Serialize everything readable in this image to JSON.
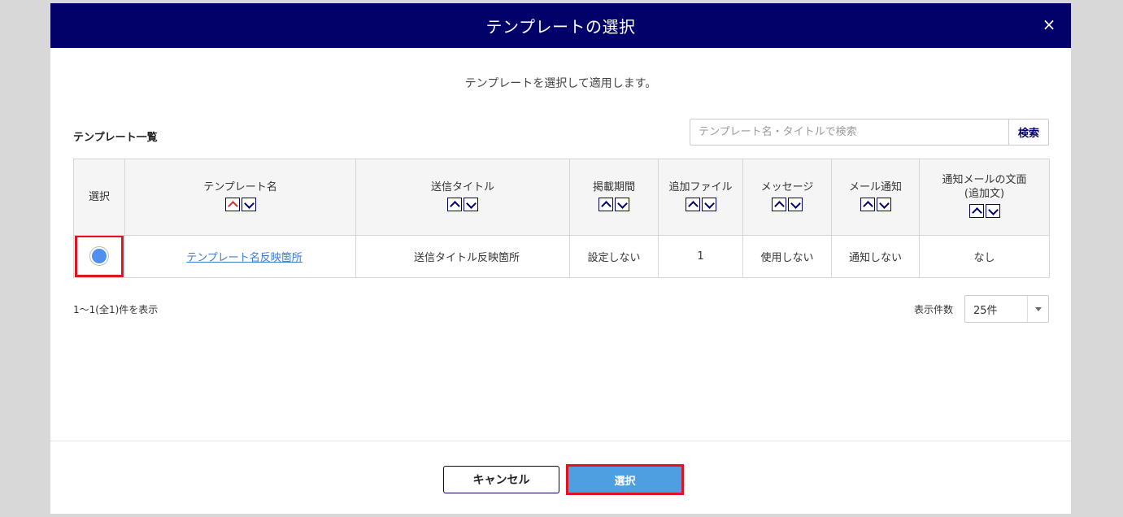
{
  "dialog": {
    "title": "テンプレートの選択",
    "close_label": "×",
    "description": "テンプレートを選択して適用します。"
  },
  "list": {
    "title": "テンプレート一覧",
    "search_placeholder": "テンプレート名・タイトルで検索",
    "search_button": "検索"
  },
  "table": {
    "headers": {
      "select": "選択",
      "template_name": "テンプレート名",
      "send_title": "送信タイトル",
      "period": "掲載期間",
      "attachment": "追加ファイル",
      "message": "メッセージ",
      "mail_notify": "メール通知",
      "mail_body_line1": "通知メールの文面",
      "mail_body_line2": "(追加文)"
    },
    "rows": [
      {
        "selected": true,
        "template_name": "テンプレート名反映箇所",
        "send_title": "送信タイトル反映箇所",
        "period": "設定しない",
        "attachment": "1",
        "message": "使用しない",
        "mail_notify": "通知しない",
        "mail_body": "なし"
      }
    ]
  },
  "pagination": {
    "count_text": "1〜1(全1)件を表示",
    "per_page_label": "表示件数",
    "per_page_value": "25件"
  },
  "footer": {
    "cancel_label": "キャンセル",
    "select_label": "選択"
  },
  "colors": {
    "header_bg": "#020069",
    "primary_button": "#4d9fe2",
    "highlight_border": "#e0141e",
    "link": "#3b7bd0"
  }
}
